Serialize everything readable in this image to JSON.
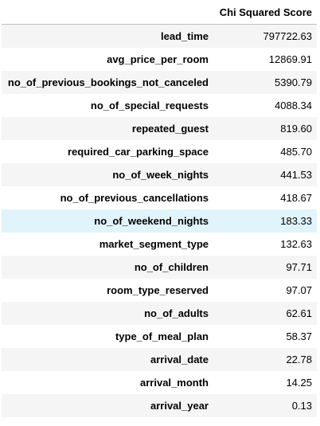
{
  "table": {
    "index_header": "",
    "column_header": "Chi Squared Score",
    "rows": [
      {
        "feature": "lead_time",
        "score": "797722.63"
      },
      {
        "feature": "avg_price_per_room",
        "score": "12869.91"
      },
      {
        "feature": "no_of_previous_bookings_not_canceled",
        "score": "5390.79"
      },
      {
        "feature": "no_of_special_requests",
        "score": "4088.34"
      },
      {
        "feature": "repeated_guest",
        "score": "819.60"
      },
      {
        "feature": "required_car_parking_space",
        "score": "485.70"
      },
      {
        "feature": "no_of_week_nights",
        "score": "441.53"
      },
      {
        "feature": "no_of_previous_cancellations",
        "score": "418.67"
      },
      {
        "feature": "no_of_weekend_nights",
        "score": "183.33"
      },
      {
        "feature": "market_segment_type",
        "score": "132.63"
      },
      {
        "feature": "no_of_children",
        "score": "97.71"
      },
      {
        "feature": "room_type_reserved",
        "score": "97.07"
      },
      {
        "feature": "no_of_adults",
        "score": "62.61"
      },
      {
        "feature": "type_of_meal_plan",
        "score": "58.37"
      },
      {
        "feature": "arrival_date",
        "score": "22.78"
      },
      {
        "feature": "arrival_month",
        "score": "14.25"
      },
      {
        "feature": "arrival_year",
        "score": "0.13"
      }
    ]
  },
  "colors": {
    "stripe": "#f5f5f5",
    "hover_highlight": "#e1f4fb",
    "header_rule": "#bdbdbd"
  }
}
